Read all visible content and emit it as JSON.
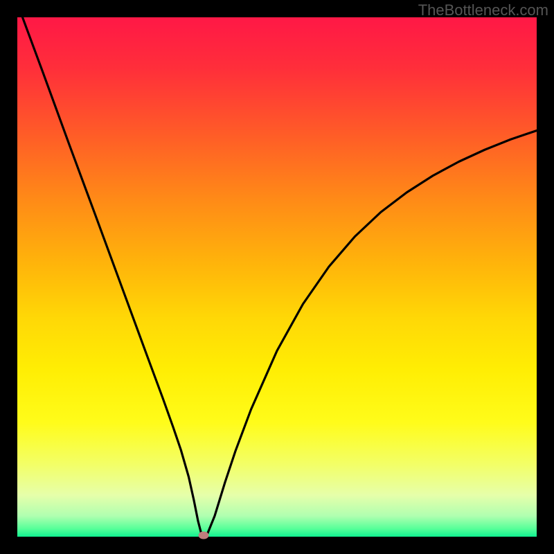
{
  "watermark": "TheBottleneck.com",
  "chart_data": {
    "type": "line",
    "title": "",
    "xlabel": "",
    "ylabel": "",
    "xlim": [
      0,
      100
    ],
    "ylim": [
      0,
      100
    ],
    "background_gradient": {
      "type": "vertical",
      "stops": [
        {
          "offset": 0.0,
          "color": "#ff1846"
        },
        {
          "offset": 0.1,
          "color": "#ff2f3a"
        },
        {
          "offset": 0.22,
          "color": "#ff5a28"
        },
        {
          "offset": 0.35,
          "color": "#ff8a17"
        },
        {
          "offset": 0.48,
          "color": "#ffb60a"
        },
        {
          "offset": 0.58,
          "color": "#ffd806"
        },
        {
          "offset": 0.68,
          "color": "#ffee04"
        },
        {
          "offset": 0.78,
          "color": "#fffc1a"
        },
        {
          "offset": 0.86,
          "color": "#f3ff66"
        },
        {
          "offset": 0.92,
          "color": "#e6ffaa"
        },
        {
          "offset": 0.96,
          "color": "#b0ffb0"
        },
        {
          "offset": 0.985,
          "color": "#55ff99"
        },
        {
          "offset": 1.0,
          "color": "#10f090"
        }
      ]
    },
    "series": [
      {
        "name": "bottleneck-curve",
        "color": "#000000",
        "x": [
          1,
          5,
          10,
          15,
          20,
          25,
          28,
          30,
          31.5,
          33,
          34,
          34.8,
          35.5,
          36.5,
          38,
          40,
          42,
          45,
          50,
          55,
          60,
          65,
          70,
          75,
          80,
          85,
          90,
          95,
          100
        ],
        "y": [
          100,
          89.2,
          75.5,
          62,
          48.4,
          34.8,
          26.7,
          21.1,
          16.7,
          11.5,
          7.0,
          3.0,
          0.3,
          0.3,
          4.0,
          10.5,
          16.5,
          24.5,
          35.8,
          44.8,
          52.0,
          57.8,
          62.5,
          66.3,
          69.5,
          72.2,
          74.5,
          76.5,
          78.2
        ]
      }
    ],
    "marker": {
      "x": 35.8,
      "y": 0.3,
      "color": "#bf7d7d"
    }
  }
}
